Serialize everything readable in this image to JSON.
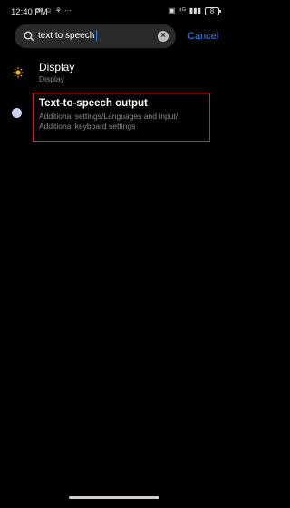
{
  "status_bar": {
    "time": "12:40 PM",
    "notification_icons": [
      "✉",
      "☺",
      "⚘",
      "···"
    ],
    "right_icons": [
      "▣",
      "⁴ᴳ",
      "▮▮▮"
    ],
    "battery": "8"
  },
  "search": {
    "query": "text to speech",
    "clear_icon": "clear-icon",
    "search_icon": "search-icon",
    "cancel_label": "Cancel"
  },
  "results": [
    {
      "title": "Display",
      "subtitle": "Display",
      "icon": "brightness-icon",
      "icon_color": "#f5b400"
    },
    {
      "title": "Text-to-speech output",
      "subtitle": "Additional settings/Languages and input/ Additional keyboard settings",
      "icon": "settings-dot-icon",
      "icon_color": "#c9d3f2",
      "highlighted": true
    }
  ],
  "colors": {
    "accent": "#3a86f7",
    "highlight_border": "#e01d2a",
    "background": "#000000"
  }
}
